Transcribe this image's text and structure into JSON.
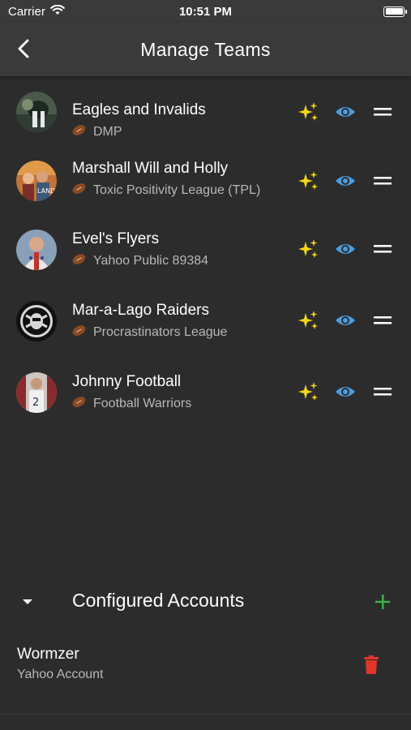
{
  "status_bar": {
    "carrier": "Carrier",
    "time": "10:51 PM"
  },
  "header": {
    "title": "Manage Teams"
  },
  "teams": [
    {
      "name": "Eagles and Invalids",
      "league": "DMP"
    },
    {
      "name": "Marshall Will and Holly",
      "league": "Toxic Positivity League (TPL)"
    },
    {
      "name": "Evel's Flyers",
      "league": "Yahoo Public 89384"
    },
    {
      "name": "Mar-a-Lago Raiders",
      "league": "Procrastinators League"
    },
    {
      "name": "Johnny Football",
      "league": "Football Warriors"
    }
  ],
  "row_icons": [
    "sparkles-icon",
    "eye-icon",
    "drag-handle-icon"
  ],
  "accounts": {
    "title": "Configured Accounts",
    "items": [
      {
        "name": "Wormzer",
        "type": "Yahoo Account"
      }
    ]
  },
  "colors": {
    "background": "#2c2c2c",
    "header": "#3a3a3a",
    "sparkle": "#f5d90a",
    "eye": "#4a9ee0",
    "add": "#3db14a",
    "delete": "#e2352b",
    "secondary_text": "#b8b8b8"
  }
}
